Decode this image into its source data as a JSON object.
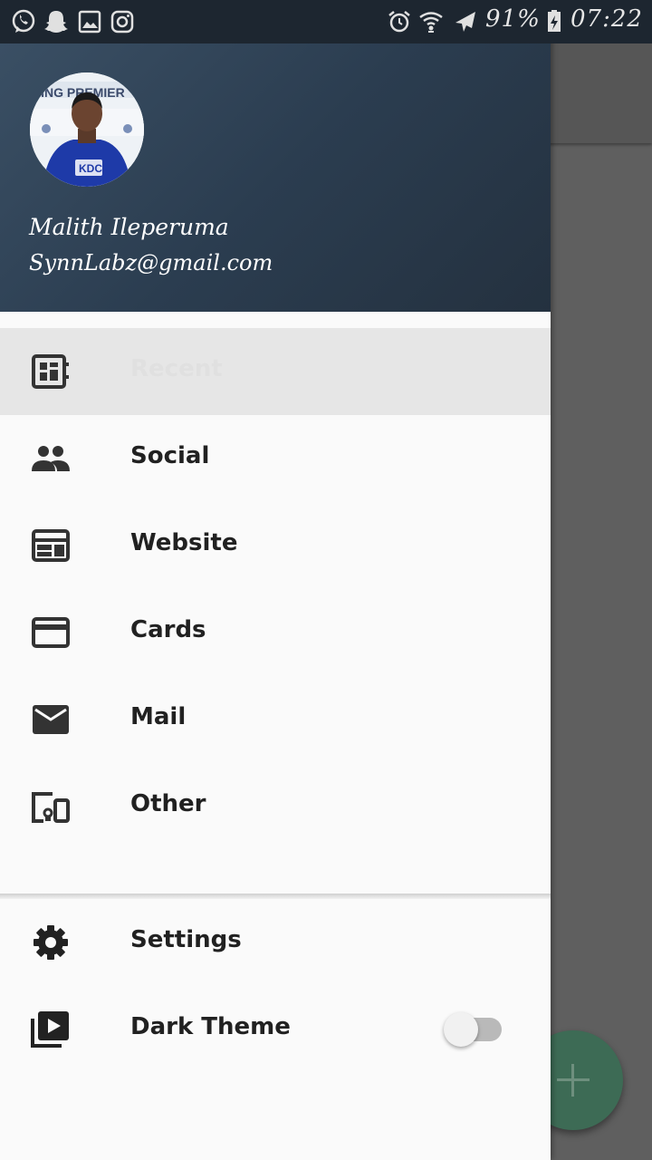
{
  "status_bar": {
    "battery": "91%",
    "time": "07:22",
    "left_icons": [
      "whatsapp-icon",
      "snapchat-icon",
      "gallery-icon",
      "instagram-icon"
    ],
    "right_icons": [
      "alarm-icon",
      "wifi-icon",
      "airplane-mode-icon",
      "battery-charging-icon"
    ]
  },
  "drawer": {
    "header": {
      "name": "Malith Ileperuma",
      "email": "SynnLabz@gmail.com"
    },
    "menu": [
      {
        "label": "Recent",
        "icon": "dashboard-icon",
        "active": true
      },
      {
        "label": "Social",
        "icon": "people-icon"
      },
      {
        "label": "Website",
        "icon": "web-icon"
      },
      {
        "label": "Cards",
        "icon": "credit-card-icon"
      },
      {
        "label": "Mail",
        "icon": "mail-icon"
      },
      {
        "label": "Other",
        "icon": "devices-icon"
      }
    ],
    "footer": [
      {
        "label": "Settings",
        "icon": "gear-icon"
      },
      {
        "label": "Dark Theme",
        "icon": "video-library-icon",
        "toggle": false
      }
    ]
  },
  "fab": {
    "icon": "plus-icon",
    "color": "#3d6b55"
  },
  "colors": {
    "header": "#2b3d50",
    "drawer_bg": "#fafafa",
    "active_item": "#e6e6e6"
  }
}
